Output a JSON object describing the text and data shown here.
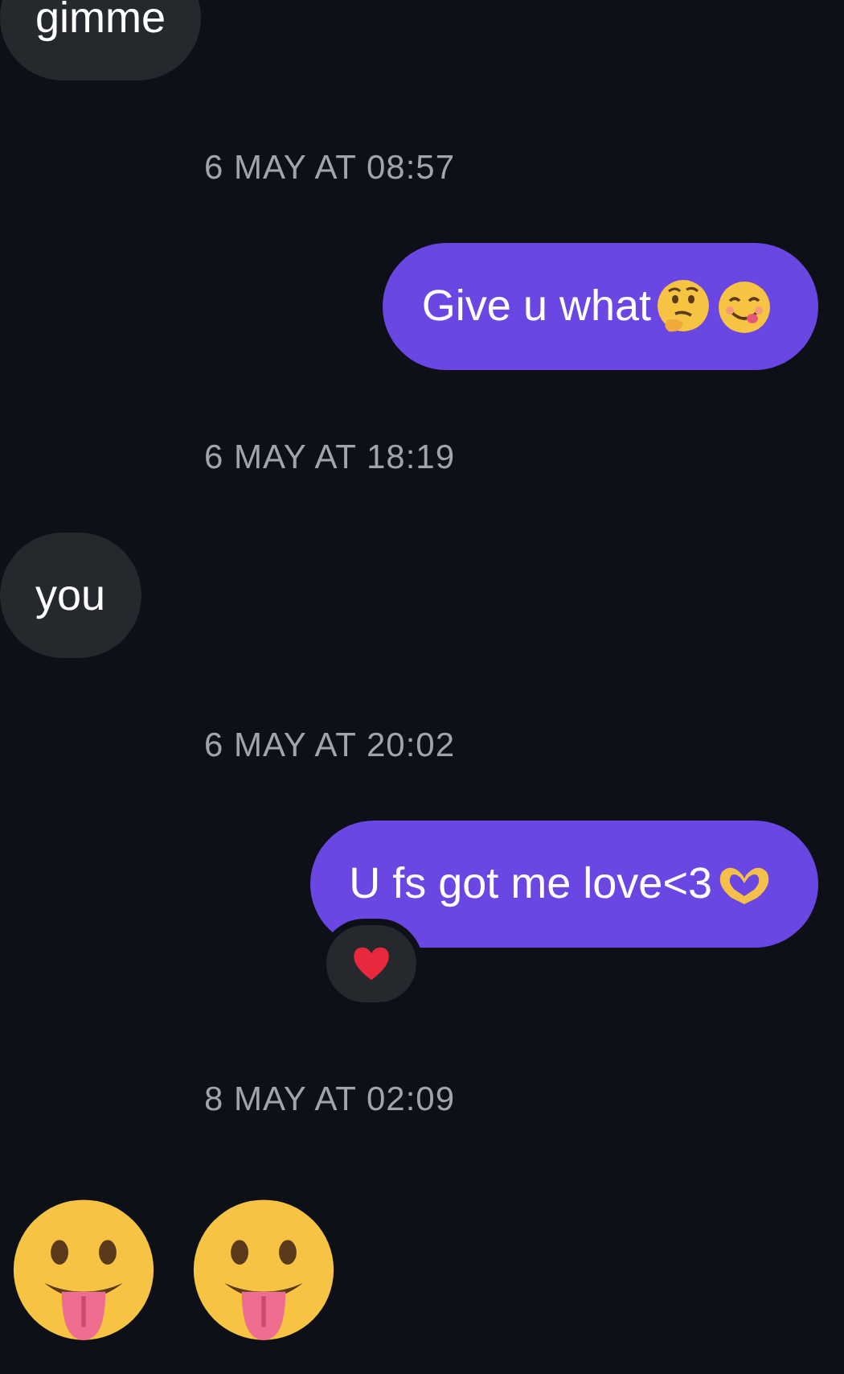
{
  "messages": [
    {
      "kind": "received",
      "text": "gimme"
    },
    {
      "kind": "timestamp",
      "text": "6 MAY AT 08:57"
    },
    {
      "kind": "sent",
      "text": "Give u what",
      "emojis": [
        {
          "kind": "thinking"
        },
        {
          "kind": "yum"
        }
      ]
    },
    {
      "kind": "timestamp",
      "text": "6 MAY AT 18:19"
    },
    {
      "kind": "received",
      "text": "you"
    },
    {
      "kind": "timestamp",
      "text": "6 MAY AT 20:02"
    },
    {
      "kind": "sent",
      "text": "U fs got me love<3",
      "emojis": [
        {
          "kind": "heart_hands"
        }
      ],
      "reaction": {
        "kind": "heart"
      }
    },
    {
      "kind": "timestamp",
      "text": "8 MAY AT 02:09"
    },
    {
      "kind": "big_emoji",
      "emojis": [
        {
          "kind": "tongue"
        },
        {
          "kind": "tongue"
        }
      ]
    }
  ]
}
